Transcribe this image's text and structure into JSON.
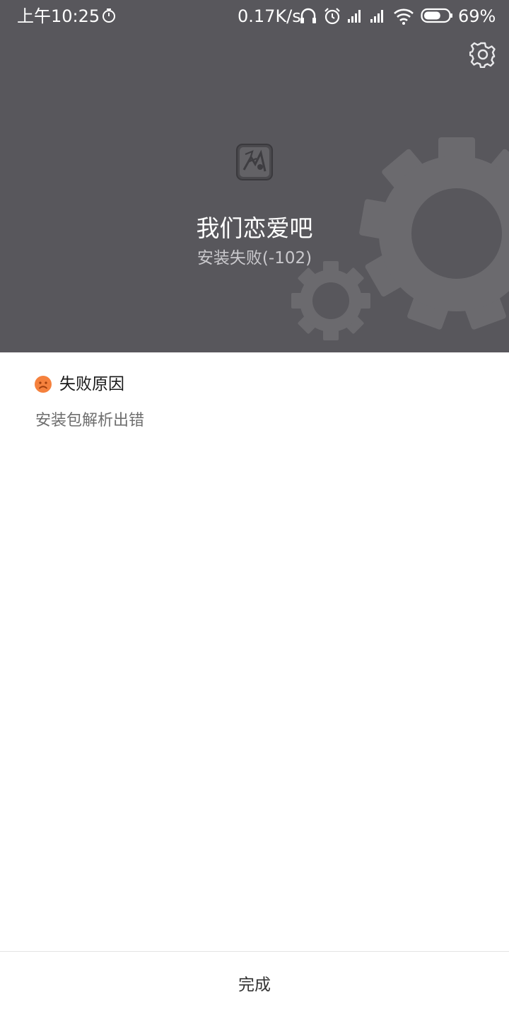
{
  "status_bar": {
    "time": "上午10:25",
    "net_speed": "0.17K/s",
    "battery_percent": "69%",
    "battery_level": 0.69,
    "icons": [
      "timer-icon",
      "headset-icon",
      "alarm-icon",
      "signal-icon",
      "signal-icon",
      "wifi-icon",
      "battery-icon"
    ]
  },
  "header": {
    "app_name": "我们恋爱吧",
    "install_status": "安装失败(-102)",
    "background_color": "#58575c",
    "icons": [
      "settings-gear-icon",
      "app-icon"
    ]
  },
  "failure": {
    "title": "失败原因",
    "detail": "安装包解析出错",
    "icon": "sad-face-icon",
    "icon_color": "#f5813d"
  },
  "footer": {
    "done_label": "完成"
  }
}
